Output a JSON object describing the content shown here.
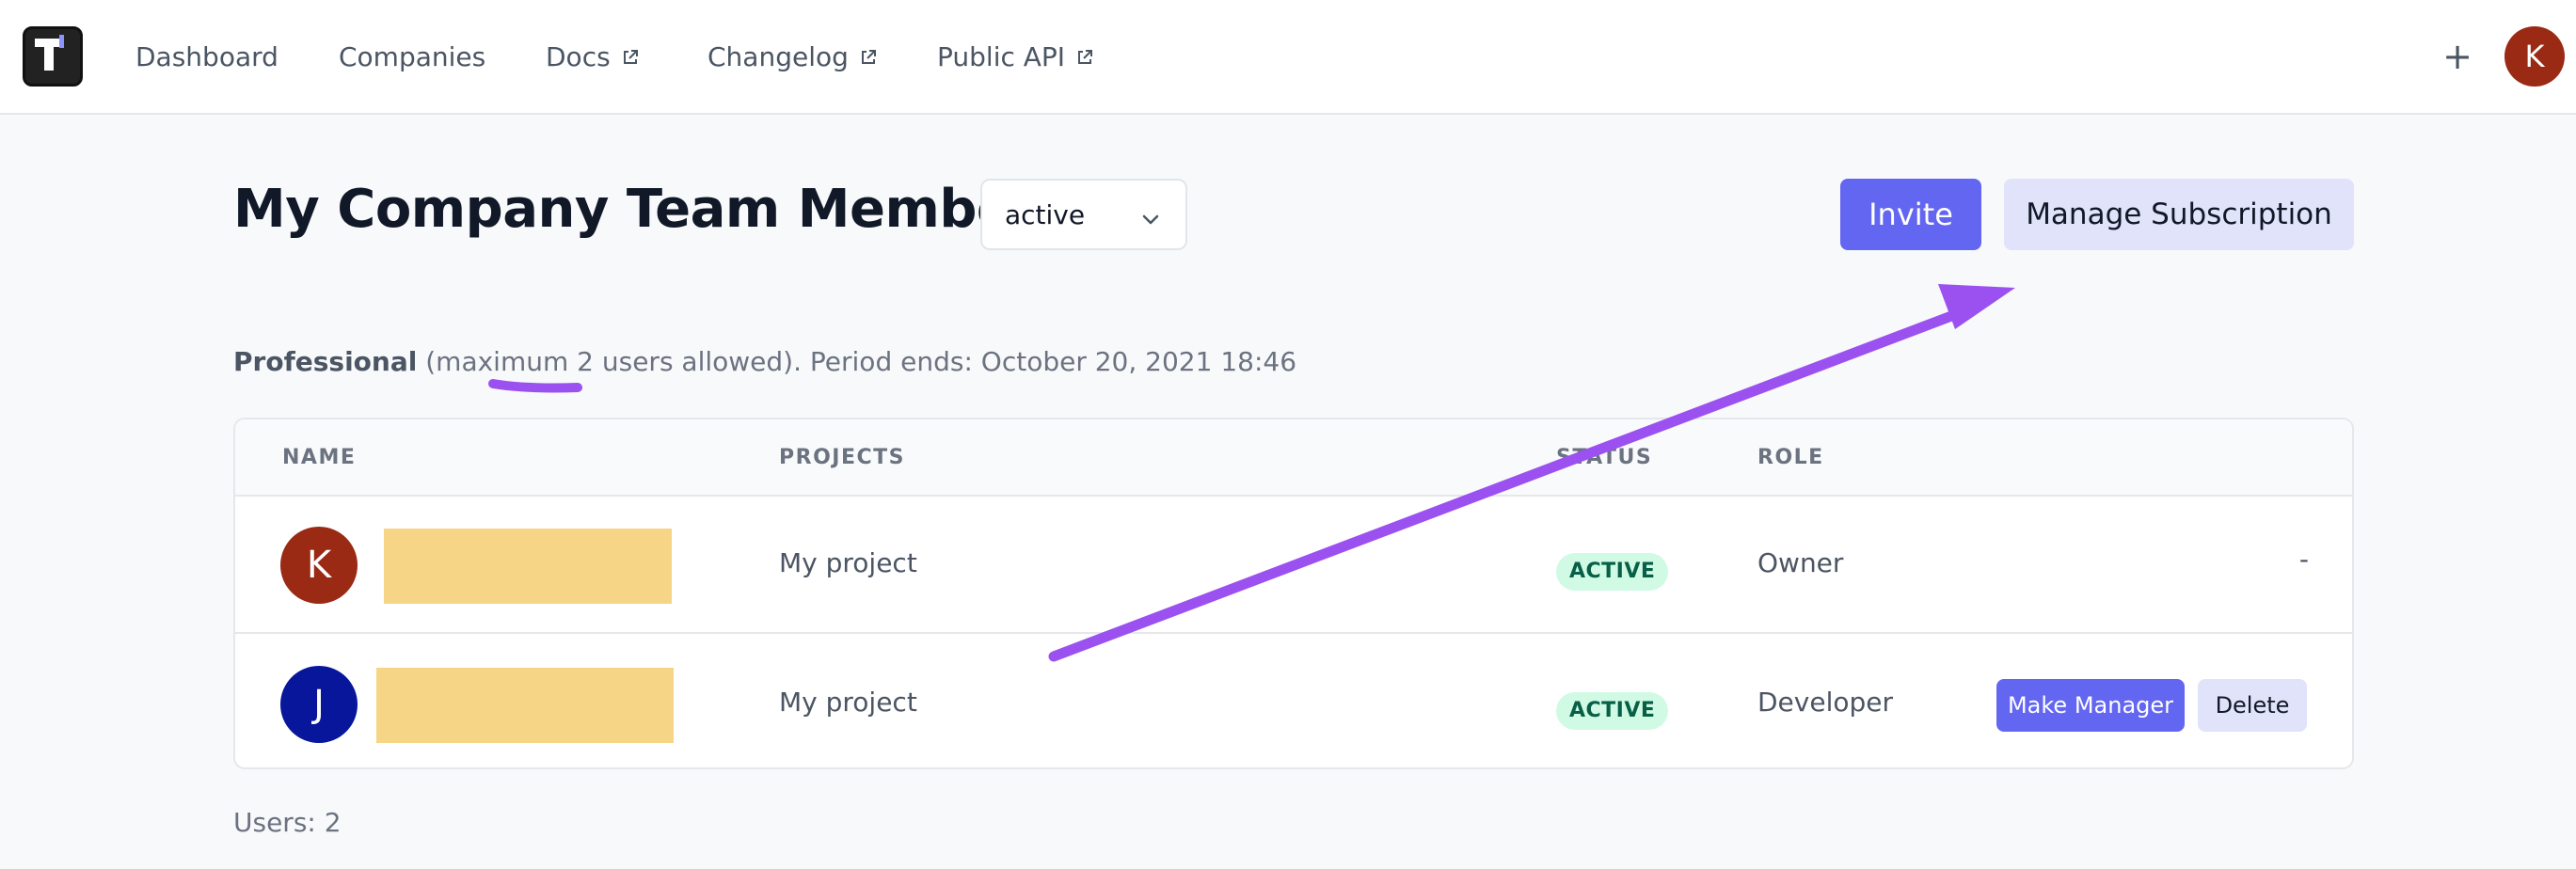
{
  "nav": {
    "items": [
      {
        "label": "Dashboard",
        "external": false
      },
      {
        "label": "Companies",
        "external": false
      },
      {
        "label": "Docs",
        "external": true
      },
      {
        "label": "Changelog",
        "external": true
      },
      {
        "label": "Public API",
        "external": true
      }
    ],
    "plus_label": "+",
    "user_initial": "K"
  },
  "page": {
    "title": "My Company Team Members",
    "status_filter": "active",
    "invite_label": "Invite",
    "manage_label": "Manage Subscription"
  },
  "plan": {
    "name": "Professional",
    "detail": "(maximum 2 users allowed). Period ends: October 20, 2021 18:46"
  },
  "table": {
    "headers": {
      "name": "NAME",
      "projects": "PROJECTS",
      "status": "STATUS",
      "role": "ROLE"
    },
    "rows": [
      {
        "initial": "K",
        "avatar_color": "#9a2a14",
        "project": "My project",
        "status": "ACTIVE",
        "role": "Owner",
        "action": "-"
      },
      {
        "initial": "J",
        "avatar_color": "#08169b",
        "project": "My project",
        "status": "ACTIVE",
        "role": "Developer",
        "make_manager_label": "Make Manager",
        "delete_label": "Delete"
      }
    ]
  },
  "footer": {
    "users_count": "Users: 2"
  },
  "colors": {
    "accent": "#6366f1",
    "annotation": "#9b51f0",
    "redaction": "#f7d586",
    "badge_bg": "#d1fae5",
    "badge_text": "#065f46"
  },
  "icons": [
    "app-logo-icon",
    "external-link-icon",
    "plus-icon",
    "chevron-down-icon"
  ]
}
